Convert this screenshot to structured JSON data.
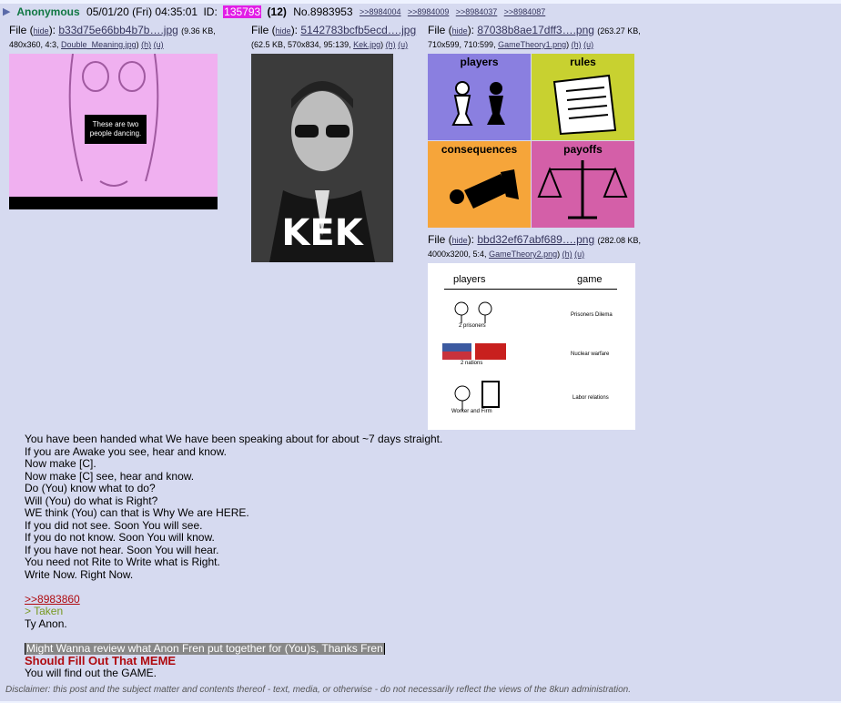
{
  "post": {
    "arrow": "▶",
    "name": "Anonymous",
    "datetime": "05/01/20 (Fri) 04:35:01",
    "id_label": "ID:",
    "id_value": "135793",
    "id_count": "(12)",
    "post_no": "No.8983953",
    "backlinks": [
      ">>8984004",
      ">>8984009",
      ">>8984037",
      ">>8984087"
    ]
  },
  "files": [
    {
      "prefix": "File (",
      "hide": "hide",
      "sep": "): ",
      "name": "b33d75e66bb4b7b….jpg",
      "meta1": "(9.36 KB,",
      "meta2": "480x360, 4:3, ",
      "orig": "Double_Meaning.jpg",
      "h": "(h)",
      "u": "(u)",
      "thumb_text": "These are two people dancing."
    },
    {
      "prefix": "File (",
      "hide": "hide",
      "sep": "): ",
      "name": "5142783bcfb5ecd….jpg",
      "meta2": "(62.5 KB, 570x834, 95:139, ",
      "orig": "Kek.jpg",
      "h": "(h)",
      "u": "(u)",
      "thumb_text": "KEK"
    },
    {
      "prefix": "File (",
      "hide": "hide",
      "sep": "): ",
      "name": "87038b8ae17dff3….png",
      "meta1": "(263.27 KB,",
      "meta2": "710x599, 710:599, ",
      "orig": "GameTheory1.png",
      "h": "(h)",
      "u": "(u)",
      "thumb_labels": [
        "players",
        "rules",
        "consequences",
        "payoffs"
      ]
    },
    {
      "prefix": "File (",
      "hide": "hide",
      "sep": "): ",
      "name": "bbd32ef67abf689….png",
      "meta1": "(282.08 KB,",
      "meta2": "4000x3200, 5:4, ",
      "orig": "GameTheory2.png",
      "h": "(h)",
      "u": "(u)",
      "thumb_header": [
        "players",
        "game"
      ],
      "thumb_rows": [
        {
          "left": "2 prisoners",
          "right": "Prisoners Dilema"
        },
        {
          "left": "2 nations",
          "right": "Nuclear warfare"
        },
        {
          "left": "Worker and Firm",
          "right": "Labor relations"
        }
      ]
    }
  ],
  "body_lines": [
    "You have been handed what We have been speaking about for about ~7 days straight.",
    "If you are Awake you see, hear and know.",
    "Now make [C].",
    "Now make [C] see, hear and know.",
    "Do (You) know what to do?",
    "Will (You) do what is Right?",
    "WE think (You) can that is Why We are HERE.",
    "If you did not see. Soon You will see.",
    "If you do not know. Soon You will know.",
    "If you have not hear. Soon You will hear.",
    "You need not Rite to Write what is Right.",
    "Write Now. Right Now."
  ],
  "quote_link": ">>8983860",
  "greentext": "> Taken",
  "thanks": "Ty Anon.",
  "spoiler": "Might Wanna review what Anon Fren put together for (You)s, Thanks Fren",
  "heading": "Should Fill Out That MEME",
  "last_line": "You will find out the GAME.",
  "disclaimer": "Disclaimer: this post and the subject matter and contents thereof - text, media, or otherwise - do not necessarily reflect the views of the 8kun administration."
}
